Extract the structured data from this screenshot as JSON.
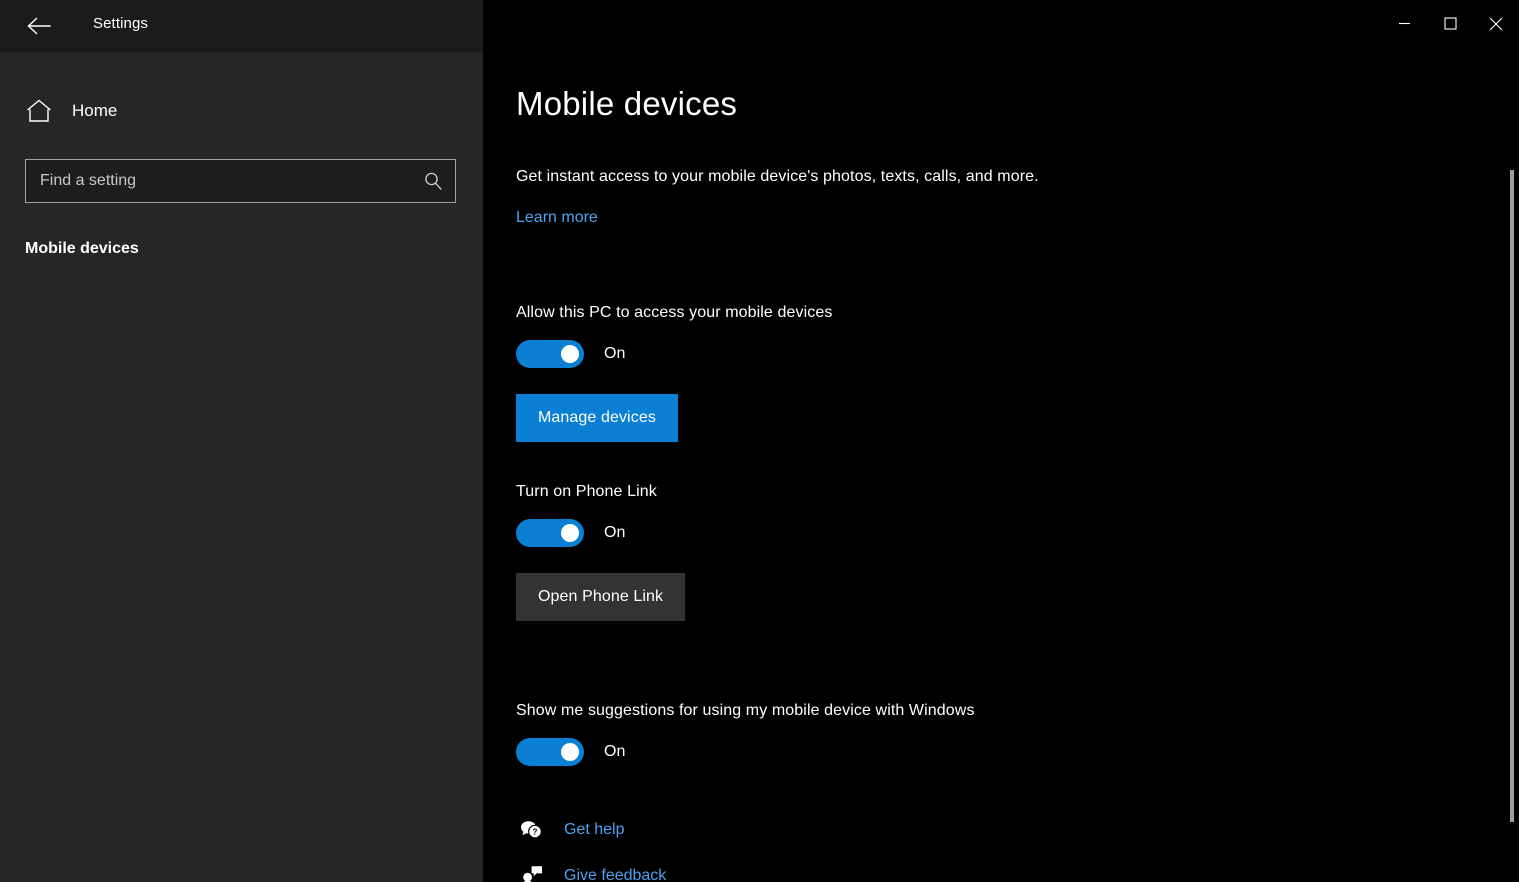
{
  "window": {
    "app_title": "Settings",
    "back_icon": "back-arrow-icon",
    "controls": {
      "minimize": "minimize-icon",
      "maximize": "maximize-icon",
      "close": "close-icon"
    }
  },
  "sidebar": {
    "home": {
      "label": "Home",
      "icon": "home-icon"
    },
    "search": {
      "placeholder": "Find a setting",
      "value": "",
      "icon": "search-icon"
    },
    "group_title": "Mobile devices"
  },
  "main": {
    "title": "Mobile devices",
    "description": "Get instant access to your mobile device's photos, texts, calls, and more.",
    "learn_more": "Learn more",
    "settings": [
      {
        "label": "Allow this PC to access your mobile devices",
        "toggle_state": "On",
        "button": "Manage devices",
        "button_style": "primary"
      },
      {
        "label": "Turn on Phone Link",
        "toggle_state": "On",
        "button": "Open Phone Link",
        "button_style": "secondary"
      },
      {
        "label": "Show me suggestions for using my mobile device with Windows",
        "toggle_state": "On"
      }
    ],
    "footer_links": [
      {
        "label": "Get help",
        "icon": "help-bubble-icon"
      },
      {
        "label": "Give feedback",
        "icon": "feedback-person-icon"
      }
    ]
  },
  "colors": {
    "accent": "#0a7fd4",
    "link": "#4ea1f0",
    "sidebar_bg": "#262626",
    "main_bg": "#000000",
    "secondary_button": "#333333"
  },
  "scrollbar": {
    "orientation": "vertical"
  }
}
